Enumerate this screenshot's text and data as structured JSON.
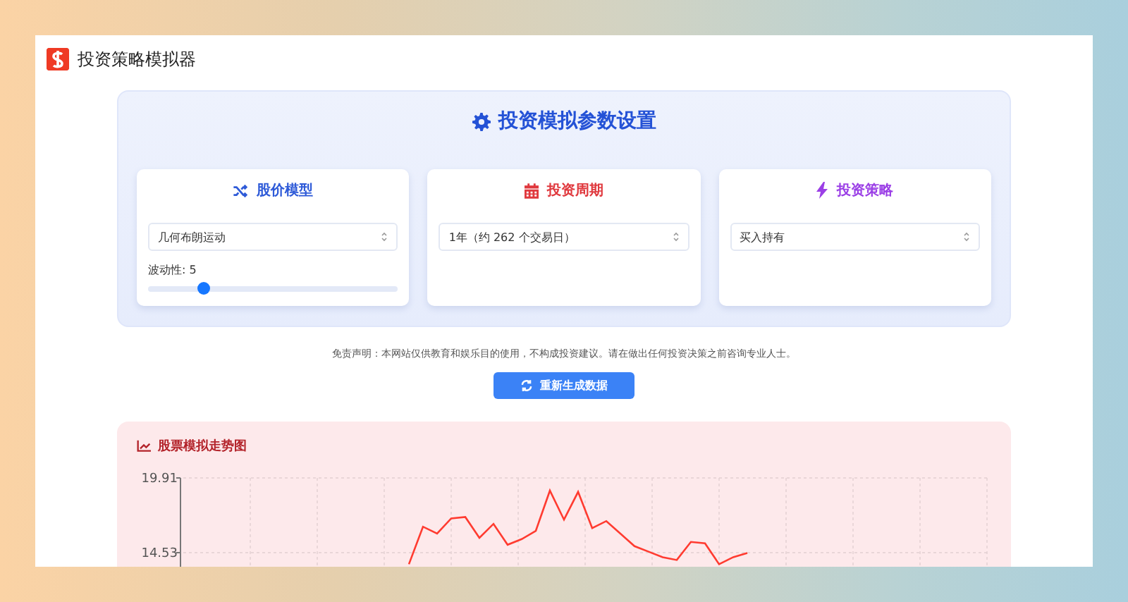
{
  "app": {
    "title": "投资策略模拟器"
  },
  "settings": {
    "title": "投资模拟参数设置",
    "cards": [
      {
        "kind": "model",
        "title": "股价模型",
        "color": "#2f5bd8",
        "select": {
          "value": "几何布朗运动"
        },
        "slider": {
          "label": "波动性: 5",
          "level": 0.22
        }
      },
      {
        "kind": "period",
        "title": "投资周期",
        "color": "#e0393e",
        "select": {
          "value": "1年（约 262 个交易日）"
        }
      },
      {
        "kind": "strategy",
        "title": "投资策略",
        "color": "#9b3fe6",
        "select": {
          "value": "买入持有"
        }
      }
    ]
  },
  "disclaimer": "免责声明：本网站仅供教育和娱乐目的使用，不构成投资建议。请在做出任何投资决策之前咨询专业人士。",
  "regenerate_button": "重新生成数据",
  "chart": {
    "title": "股票模拟走势图",
    "chart_data": {
      "type": "line",
      "ylim": [
        13.5,
        19.91
      ],
      "grid": true,
      "yticks": [
        19.91,
        14.53
      ],
      "categories": [
        null,
        null,
        null,
        null,
        null,
        null,
        null,
        null,
        null,
        null,
        null,
        null,
        null,
        null,
        null,
        null,
        null,
        null,
        null,
        null,
        null,
        null,
        null,
        null,
        null,
        null,
        null,
        null,
        null,
        null,
        null,
        null,
        null,
        null,
        null,
        null,
        null,
        null,
        null,
        null,
        null,
        null,
        null,
        null,
        null,
        null,
        null,
        null,
        null,
        null,
        null,
        null,
        null,
        null,
        null,
        null,
        null,
        null
      ],
      "series": [
        {
          "color": "#ff3b30",
          "values": [
            null,
            null,
            null,
            null,
            null,
            null,
            null,
            null,
            null,
            null,
            null,
            null,
            null,
            null,
            null,
            null,
            13.7,
            16.4,
            15.9,
            17.0,
            17.1,
            15.6,
            16.6,
            15.1,
            15.5,
            16.1,
            19.0,
            16.9,
            18.9,
            16.3,
            16.8,
            15.9,
            15.0,
            14.6,
            14.2,
            14.0,
            15.3,
            15.2,
            13.7,
            14.2,
            14.5,
            null,
            null,
            null,
            null,
            null,
            null,
            null,
            null,
            null,
            null,
            null,
            null,
            null,
            null,
            null,
            null,
            null
          ]
        }
      ]
    }
  }
}
